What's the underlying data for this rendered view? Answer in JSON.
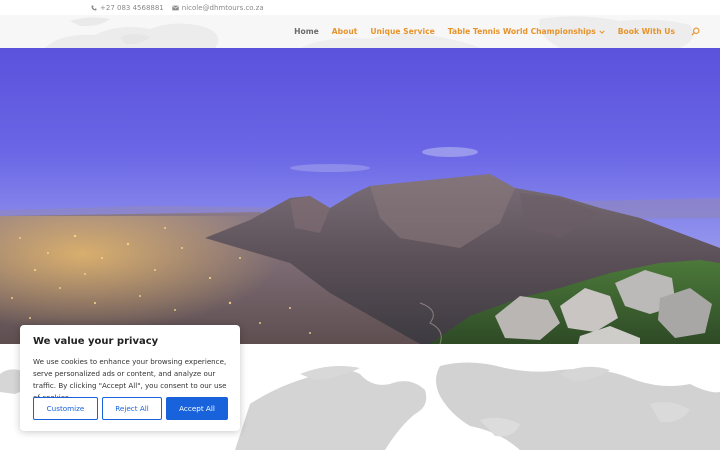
{
  "top_bar": {
    "phone": "+27 083 4568881",
    "email": "nicole@dhmtours.co.za",
    "text_color": "#8a8a8a"
  },
  "nav": {
    "items": [
      {
        "label": "Home",
        "active": false
      },
      {
        "label": "About",
        "active": false
      },
      {
        "label": "Unique Service",
        "active": false
      },
      {
        "label": "Table Tennis World Championships",
        "has_dropdown": true
      },
      {
        "label": "Book With Us",
        "active": false
      }
    ],
    "search_icon": "search-icon",
    "home_color": "#6b6b6b",
    "accent_color": "#e8932a"
  },
  "hero": {
    "image": "Cape Town panorama at dusk with Table Mountain and city lights"
  },
  "cookie": {
    "title": "We value your privacy",
    "text": "We use cookies to enhance your browsing experience, serve personalized ads or content, and analyze our traffic. By clicking \"Accept All\", you consent to our use of cookies.",
    "buttons": {
      "customize": "Customize",
      "reject": "Reject All",
      "accept": "Accept All"
    },
    "primary_color": "#1863dc"
  }
}
